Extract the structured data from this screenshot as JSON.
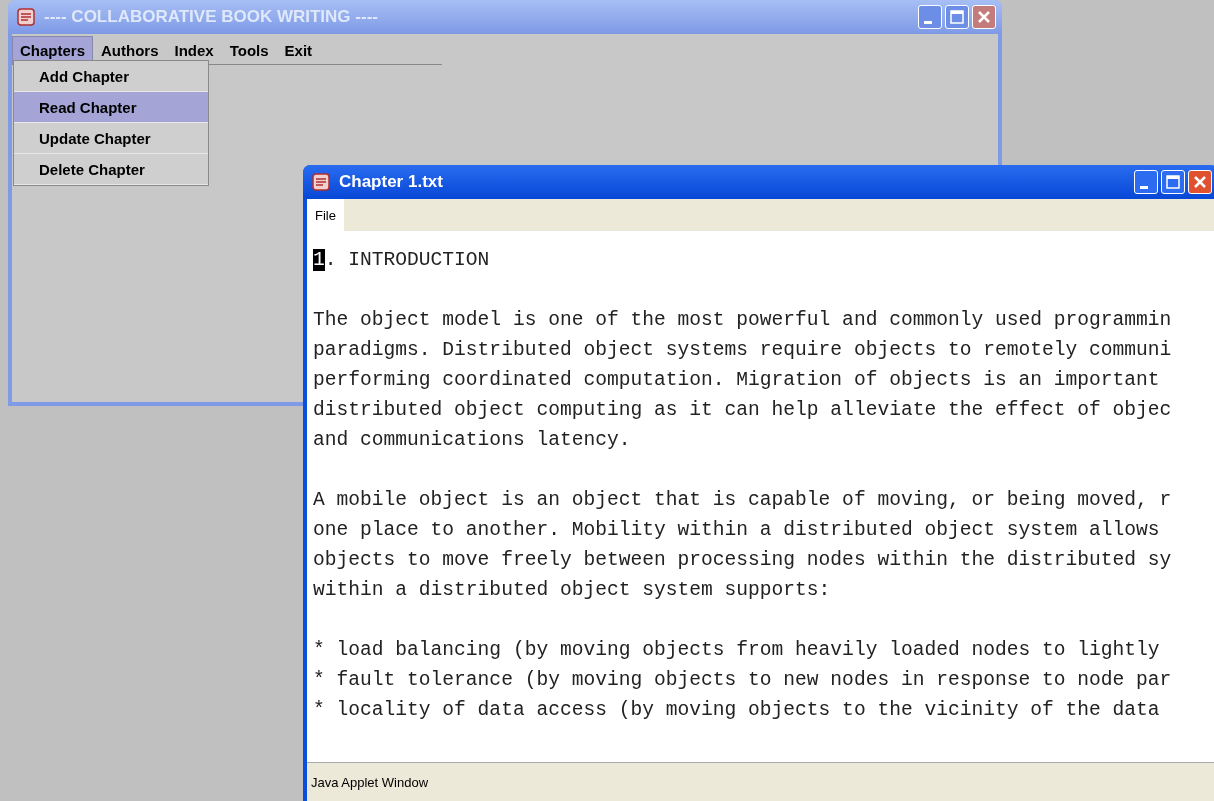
{
  "main_window": {
    "title": "---- COLLABORATIVE BOOK WRITING ----",
    "active": false,
    "menu_bar": [
      {
        "label": "Chapters",
        "selected": true
      },
      {
        "label": "Authors",
        "selected": false
      },
      {
        "label": "Index",
        "selected": false
      },
      {
        "label": "Tools",
        "selected": false
      },
      {
        "label": "Exit",
        "selected": false
      }
    ],
    "dropdown": [
      {
        "label": "Add Chapter",
        "selected": false
      },
      {
        "label": "Read Chapter",
        "selected": true
      },
      {
        "label": "Update Chapter",
        "selected": false
      },
      {
        "label": "Delete Chapter",
        "selected": false
      }
    ]
  },
  "chapter_window": {
    "title": "Chapter 1.txt",
    "active": true,
    "menu_bar": [
      {
        "label": "File",
        "selected": false
      }
    ],
    "heading": {
      "selected_text": "1",
      "text": ". INTRODUCTION"
    },
    "paragraphs": [
      [
        "The object model is one of the most powerful and commonly used programmin",
        "paradigms. Distributed object systems require objects to remotely communi",
        "performing coordinated computation. Migration of objects is an important",
        "distributed object computing as it can help alleviate the effect of objec",
        "and communications latency."
      ],
      [
        "A mobile object is an object that is capable of moving, or being moved, r",
        "one place to another. Mobility within a distributed object system allows",
        "objects to move freely between processing nodes within the distributed sy",
        "within a distributed object system supports:"
      ],
      [
        "* load balancing (by moving objects from heavily loaded nodes to lightly",
        "* fault tolerance (by moving objects to new nodes in response to node par",
        "* locality of data access (by moving objects to the vicinity of the data"
      ]
    ],
    "status_bar": "Java Applet Window"
  }
}
